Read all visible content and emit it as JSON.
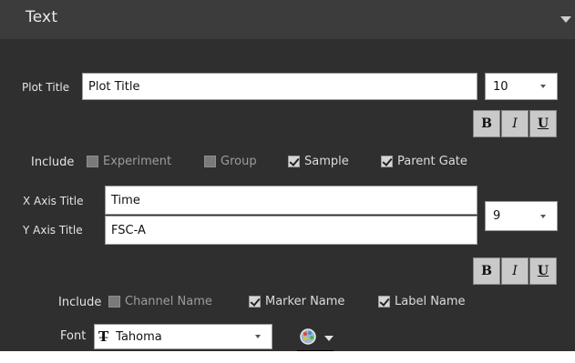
{
  "header": {
    "title": "Text"
  },
  "plot_title": {
    "label": "Plot Title",
    "value": "Plot Title",
    "size": "10"
  },
  "format_labels": {
    "bold": "B",
    "italic": "I",
    "underline": "U"
  },
  "include1": {
    "label": "Include",
    "options": [
      {
        "label": "Experiment",
        "checked": false
      },
      {
        "label": "Group",
        "checked": false
      },
      {
        "label": "Sample",
        "checked": true
      },
      {
        "label": "Parent Gate",
        "checked": true
      }
    ]
  },
  "axis": {
    "x_label": "X Axis Title",
    "x_value": "Time",
    "y_label": "Y Axis Title",
    "y_value": "FSC-A",
    "size": "9"
  },
  "include2": {
    "label": "Include",
    "options": [
      {
        "label": "Channel Name",
        "checked": false
      },
      {
        "label": "Marker Name",
        "checked": true
      },
      {
        "label": "Label Name",
        "checked": true
      }
    ]
  },
  "font": {
    "label": "Font",
    "value": "Tahoma",
    "icon": "font-type-icon",
    "color_icon": "color-palette-icon",
    "selected_color": "#000000"
  }
}
